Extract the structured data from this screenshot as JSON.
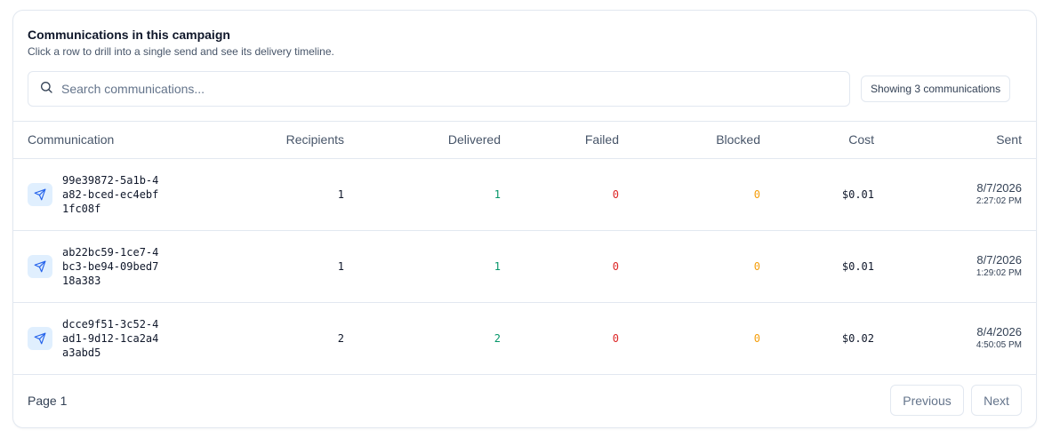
{
  "card": {
    "title": "Communications in this campaign",
    "subtitle": "Click a row to drill into a single send and see its delivery timeline."
  },
  "search": {
    "placeholder": "Search communications...",
    "value": ""
  },
  "count_badge": "Showing 3 communications",
  "table": {
    "headers": {
      "communication": "Communication",
      "recipients": "Recipients",
      "delivered": "Delivered",
      "failed": "Failed",
      "blocked": "Blocked",
      "cost": "Cost",
      "sent": "Sent"
    },
    "rows": [
      {
        "id": "99e39872-5a1b-4a82-bced-ec4ebf1fc08f",
        "recipients": "1",
        "delivered": "1",
        "failed": "0",
        "blocked": "0",
        "cost": "$0.01",
        "sent_date": "8/7/2026",
        "sent_time": "2:27:02 PM"
      },
      {
        "id": "ab22bc59-1ce7-4bc3-be94-09bed718a383",
        "recipients": "1",
        "delivered": "1",
        "failed": "0",
        "blocked": "0",
        "cost": "$0.01",
        "sent_date": "8/7/2026",
        "sent_time": "1:29:02 PM"
      },
      {
        "id": "dcce9f51-3c52-4ad1-9d12-1ca2a4a3abd5",
        "recipients": "2",
        "delivered": "2",
        "failed": "0",
        "blocked": "0",
        "cost": "$0.02",
        "sent_date": "8/4/2026",
        "sent_time": "4:50:05 PM"
      }
    ]
  },
  "footer": {
    "page_label": "Page 1",
    "previous_label": "Previous",
    "next_label": "Next"
  },
  "colors": {
    "delivered": "#059669",
    "failed": "#dc2626",
    "blocked": "#f59e0b",
    "icon_accent": "#2563eb"
  },
  "icons": {
    "search": "search-icon",
    "row": "send-icon"
  }
}
